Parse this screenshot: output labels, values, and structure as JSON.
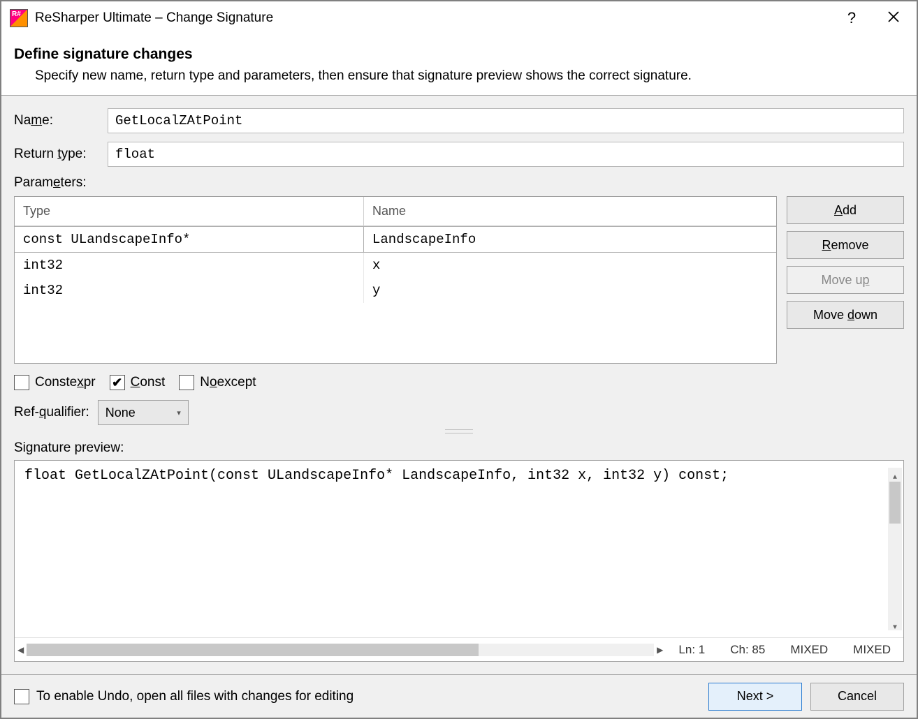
{
  "window": {
    "title": "ReSharper Ultimate – Change Signature"
  },
  "header": {
    "title": "Define signature changes",
    "subtitle": "Specify new name, return type and parameters, then ensure that signature preview shows the correct signature."
  },
  "form": {
    "name_label": "Name:",
    "name_value": "GetLocalZAtPoint",
    "return_label": "Return type:",
    "return_value": "float",
    "params_label": "Parameters:",
    "columns": {
      "type": "Type",
      "name": "Name"
    },
    "rows": [
      {
        "type": "const ULandscapeInfo*",
        "name": "LandscapeInfo",
        "selected": true
      },
      {
        "type": "int32",
        "name": "x",
        "selected": false
      },
      {
        "type": "int32",
        "name": "y",
        "selected": false
      }
    ],
    "buttons": {
      "add": "Add",
      "remove": "Remove",
      "move_up": "Move up",
      "move_down": "Move down"
    }
  },
  "modifiers": {
    "constexpr": {
      "label": "Constexpr",
      "checked": false
    },
    "const": {
      "label": "Const",
      "checked": true
    },
    "noexcept": {
      "label": "Noexcept",
      "checked": false
    }
  },
  "ref_qualifier": {
    "label": "Ref-qualifier:",
    "value": "None"
  },
  "preview": {
    "label": "Signature preview:",
    "text": "float GetLocalZAtPoint(const ULandscapeInfo* LandscapeInfo, int32 x, int32 y) const;",
    "status": {
      "ln": "Ln: 1",
      "ch": "Ch: 85",
      "enc1": "MIXED",
      "enc2": "MIXED"
    }
  },
  "footer": {
    "undo_label": "To enable Undo, open all files with changes for editing",
    "next": "Next >",
    "cancel": "Cancel"
  }
}
